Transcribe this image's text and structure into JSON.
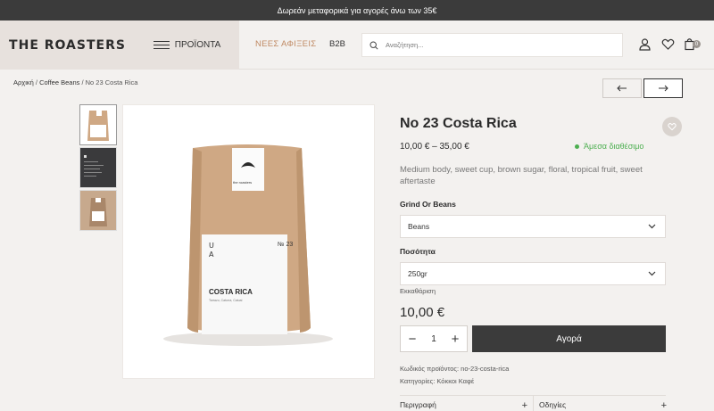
{
  "announcement": "Δωρεάν μεταφορικά για αγορές άνω των 35€",
  "header": {
    "logo": "THE ROASTERS",
    "menu_label": "ΠΡΟΪΟΝΤΑ",
    "nav_new": "ΝΕΕΣ ΑΦΙΞΕΙΣ",
    "nav_b2b": "B2B",
    "search_placeholder": "Αναζήτηση...",
    "cart_count": "0"
  },
  "breadcrumb": {
    "home": "Αρχική",
    "category": "Coffee Beans",
    "current": "No 23 Costa Rica",
    "sep": " / "
  },
  "product": {
    "title": "No 23 Costa Rica",
    "price_range": "10,00 € – 35,00 €",
    "stock": "Άμεσα διαθέσιμο",
    "description": "Medium body, sweet cup, brown sugar, floral, tropical fruit, sweet aftertaste",
    "grind_label": "Grind Or Beans",
    "grind_value": "Beans",
    "qty_label": "Ποσότητα",
    "qty_value": "250gr",
    "clear": "Εκκαθάριση",
    "price": "10,00 €",
    "quantity": "1",
    "add_to_cart": "Αγορά",
    "sku": "Κωδικός προϊόντος: no-23-costa-rica",
    "categories": "Κατηγορίες: Κόκκοι Καφέ",
    "bag_brand": "the roasters",
    "bag_number": "№ 23",
    "bag_name": "COSTA RICA",
    "bag_sub": "Tarrazu, Caturra, Catuai"
  },
  "tabs": {
    "description": "Περιγραφή",
    "instructions": "Οδηγίες"
  },
  "colors": {
    "accent": "#c08a64",
    "dark": "#3b3b3b",
    "stock": "#4caf50",
    "bag": "#cfa884"
  }
}
